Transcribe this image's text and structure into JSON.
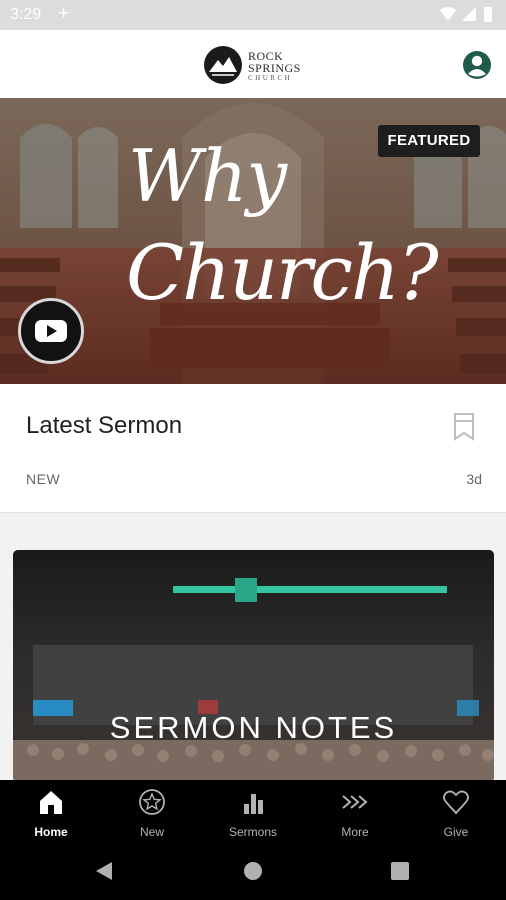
{
  "status_bar": {
    "time": "3:29",
    "plus": "+"
  },
  "header": {
    "logo": {
      "line1": "ROCK",
      "line2": "SPRINGS",
      "line3": "CHURCH"
    },
    "account_icon": "account-circle-icon"
  },
  "hero": {
    "title_line1": "Why",
    "title_line2": "Church?",
    "badge": "FEATURED",
    "play_icon": "youtube-icon"
  },
  "latest": {
    "title": "Latest Sermon",
    "tag": "NEW",
    "age": "3d",
    "bookmark_icon": "bookmark-icon"
  },
  "notes_card": {
    "title": "SERMON NOTES"
  },
  "bottom_nav": {
    "items": [
      {
        "label": "Home",
        "icon": "home-icon",
        "active": true
      },
      {
        "label": "New",
        "icon": "star-icon",
        "active": false
      },
      {
        "label": "Sermons",
        "icon": "bars-icon",
        "active": false
      },
      {
        "label": "More",
        "icon": "chevrons-icon",
        "active": false
      },
      {
        "label": "Give",
        "icon": "heart-icon",
        "active": false
      }
    ]
  },
  "colors": {
    "accent": "#1e5b4a",
    "nav_bg": "#000000",
    "featured_bg": "#1e1e1e",
    "stage_light": "#34c4a0"
  }
}
